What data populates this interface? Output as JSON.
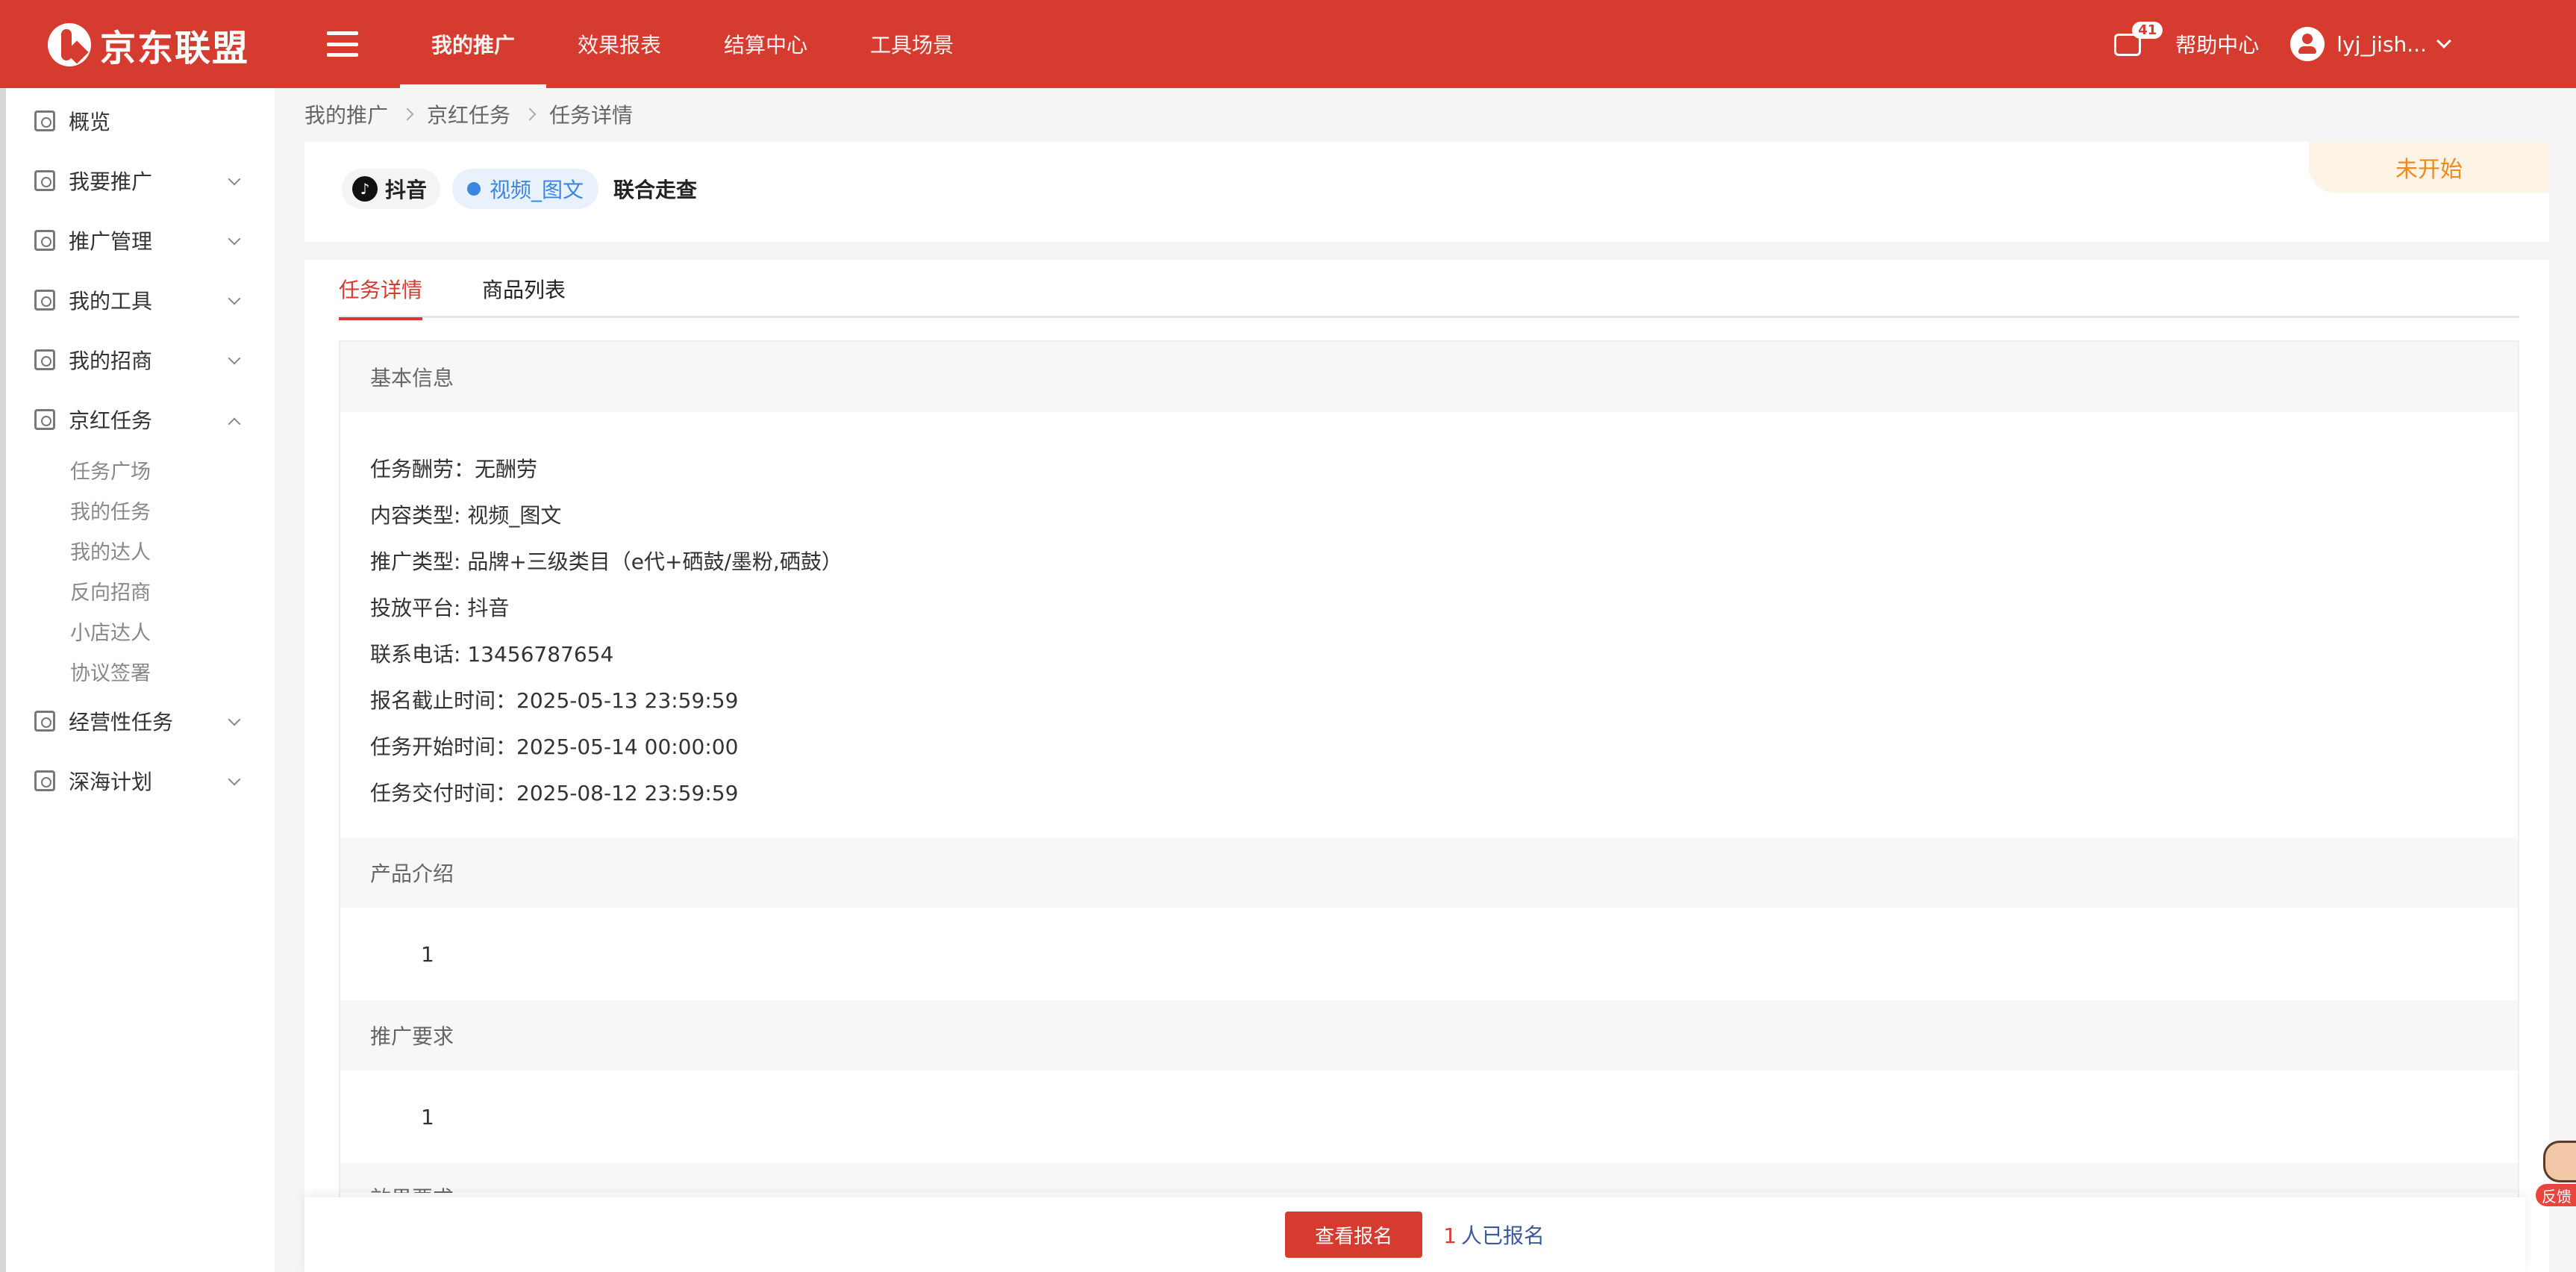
{
  "header": {
    "logo_text": "京东联盟",
    "nav": [
      {
        "label": "我的推广",
        "active": true
      },
      {
        "label": "效果报表",
        "active": false
      },
      {
        "label": "结算中心",
        "active": false
      },
      {
        "label": "工具场景",
        "active": false
      }
    ],
    "message_badge": "41",
    "help_label": "帮助中心",
    "username": "lyj_jish..."
  },
  "sidebar": {
    "items": [
      {
        "label": "概览"
      },
      {
        "label": "我要推广"
      },
      {
        "label": "推广管理"
      },
      {
        "label": "我的工具"
      },
      {
        "label": "我的招商"
      },
      {
        "label": "京红任务"
      },
      {
        "label": "经营性任务"
      },
      {
        "label": "深海计划"
      }
    ],
    "sub_items": [
      "任务广场",
      "我的任务",
      "我的达人",
      "反向招商",
      "小店达人",
      "协议签署"
    ]
  },
  "breadcrumb": [
    "我的推广",
    "京红任务",
    "任务详情"
  ],
  "task": {
    "platform": "抖音",
    "content_type": "视频_图文",
    "name": "联合走查",
    "status": "未开始"
  },
  "tabs": [
    "任务详情",
    "商品列表"
  ],
  "basic_info": {
    "title": "基本信息",
    "rows": [
      "任务酬劳：无酬劳",
      "内容类型: 视频_图文",
      "推广类型: 品牌+三级类目（e代+硒鼓/墨粉,硒鼓）",
      "投放平台: 抖音",
      "联系电话: 13456787654",
      "报名截止时间：2025-05-13 23:59:59",
      "任务开始时间：2025-05-14 00:00:00",
      "任务交付时间：2025-08-12 23:59:59"
    ]
  },
  "product_intro": {
    "title": "产品介绍",
    "value": "1"
  },
  "promo_req": {
    "title": "推广要求",
    "value": "1"
  },
  "next_section_partial": "效果要求",
  "bottom": {
    "button_label": "查看报名",
    "count": "1",
    "count_suffix": "人已报名"
  },
  "feedback_label": "反馈",
  "colors": {
    "brand": "#d63b2f",
    "accent_blue": "#3a86e0",
    "status_orange": "#f08a1c"
  }
}
